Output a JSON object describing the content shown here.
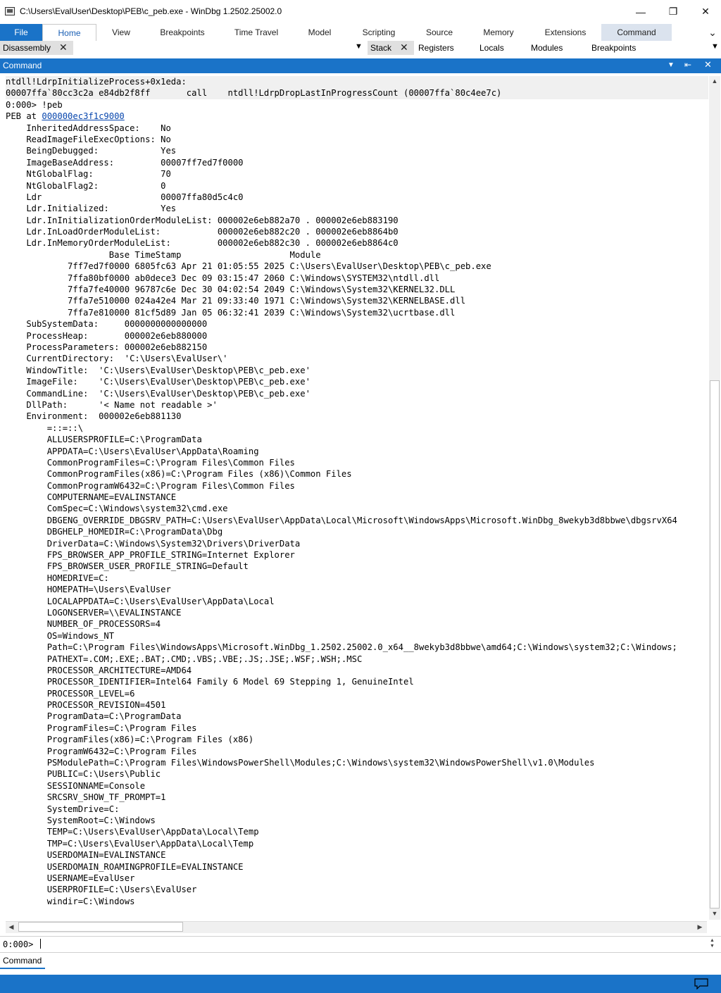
{
  "window": {
    "title": "C:\\Users\\EvalUser\\Desktop\\PEB\\c_peb.exe - WinDbg 1.2502.25002.0",
    "minimize_glyph": "—",
    "restore_glyph": "❐",
    "close_glyph": "✕"
  },
  "ribbon": {
    "tabs": [
      "File",
      "Home",
      "View",
      "Breakpoints",
      "Time Travel",
      "Model",
      "Scripting",
      "Source",
      "Memory",
      "Extensions",
      "Command"
    ],
    "expand_glyph": "⌄"
  },
  "doc_tabs": {
    "left": [
      "Disassembly"
    ],
    "right": [
      "Stack",
      "Registers",
      "Locals",
      "Modules",
      "Breakpoints"
    ]
  },
  "command_panel": {
    "title": "Command"
  },
  "output": {
    "lines": [
      "ntdll!LdrpInitializeProcess+0x1eda:",
      "00007ffa`80cc3c2a e84db2f8ff       call    ntdll!LdrpDropLastInProgressCount (00007ffa`80c4ee7c)",
      "0:000> !peb",
      "PEB at ",
      "    InheritedAddressSpace:    No",
      "    ReadImageFileExecOptions: No",
      "    BeingDebugged:            Yes",
      "    ImageBaseAddress:         00007ff7ed7f0000",
      "    NtGlobalFlag:             70",
      "    NtGlobalFlag2:            0",
      "    Ldr                       00007ffa80d5c4c0",
      "    Ldr.Initialized:          Yes",
      "    Ldr.InInitializationOrderModuleList: 000002e6eb882a70 . 000002e6eb883190",
      "    Ldr.InLoadOrderModuleList:           000002e6eb882c20 . 000002e6eb8864b0",
      "    Ldr.InMemoryOrderModuleList:         000002e6eb882c30 . 000002e6eb8864c0",
      "                    Base TimeStamp                     Module",
      "            7ff7ed7f0000 6805fc63 Apr 21 01:05:55 2025 C:\\Users\\EvalUser\\Desktop\\PEB\\c_peb.exe",
      "            7ffa80bf0000 ab0dece3 Dec 09 03:15:47 2060 C:\\Windows\\SYSTEM32\\ntdll.dll",
      "            7ffa7fe40000 96787c6e Dec 30 04:02:54 2049 C:\\Windows\\System32\\KERNEL32.DLL",
      "            7ffa7e510000 024a42e4 Mar 21 09:33:40 1971 C:\\Windows\\System32\\KERNELBASE.dll",
      "            7ffa7e810000 81cf5d89 Jan 05 06:32:41 2039 C:\\Windows\\System32\\ucrtbase.dll",
      "    SubSystemData:     0000000000000000",
      "    ProcessHeap:       000002e6eb880000",
      "    ProcessParameters: 000002e6eb882150",
      "    CurrentDirectory:  'C:\\Users\\EvalUser\\'",
      "    WindowTitle:  'C:\\Users\\EvalUser\\Desktop\\PEB\\c_peb.exe'",
      "    ImageFile:    'C:\\Users\\EvalUser\\Desktop\\PEB\\c_peb.exe'",
      "    CommandLine:  'C:\\Users\\EvalUser\\Desktop\\PEB\\c_peb.exe'",
      "    DllPath:      '< Name not readable >'",
      "    Environment:  000002e6eb881130",
      "        =::=::\\",
      "        ALLUSERSPROFILE=C:\\ProgramData",
      "        APPDATA=C:\\Users\\EvalUser\\AppData\\Roaming",
      "        CommonProgramFiles=C:\\Program Files\\Common Files",
      "        CommonProgramFiles(x86)=C:\\Program Files (x86)\\Common Files",
      "        CommonProgramW6432=C:\\Program Files\\Common Files",
      "        COMPUTERNAME=EVALINSTANCE",
      "        ComSpec=C:\\Windows\\system32\\cmd.exe",
      "        DBGENG_OVERRIDE_DBGSRV_PATH=C:\\Users\\EvalUser\\AppData\\Local\\Microsoft\\WindowsApps\\Microsoft.WinDbg_8wekyb3d8bbwe\\dbgsrvX64",
      "        DBGHELP_HOMEDIR=C:\\ProgramData\\Dbg",
      "        DriverData=C:\\Windows\\System32\\Drivers\\DriverData",
      "        FPS_BROWSER_APP_PROFILE_STRING=Internet Explorer",
      "        FPS_BROWSER_USER_PROFILE_STRING=Default",
      "        HOMEDRIVE=C:",
      "        HOMEPATH=\\Users\\EvalUser",
      "        LOCALAPPDATA=C:\\Users\\EvalUser\\AppData\\Local",
      "        LOGONSERVER=\\\\EVALINSTANCE",
      "        NUMBER_OF_PROCESSORS=4",
      "        OS=Windows_NT",
      "        Path=C:\\Program Files\\WindowsApps\\Microsoft.WinDbg_1.2502.25002.0_x64__8wekyb3d8bbwe\\amd64;C:\\Windows\\system32;C:\\Windows;",
      "        PATHEXT=.COM;.EXE;.BAT;.CMD;.VBS;.VBE;.JS;.JSE;.WSF;.WSH;.MSC",
      "        PROCESSOR_ARCHITECTURE=AMD64",
      "        PROCESSOR_IDENTIFIER=Intel64 Family 6 Model 69 Stepping 1, GenuineIntel",
      "        PROCESSOR_LEVEL=6",
      "        PROCESSOR_REVISION=4501",
      "        ProgramData=C:\\ProgramData",
      "        ProgramFiles=C:\\Program Files",
      "        ProgramFiles(x86)=C:\\Program Files (x86)",
      "        ProgramW6432=C:\\Program Files",
      "        PSModulePath=C:\\Program Files\\WindowsPowerShell\\Modules;C:\\Windows\\system32\\WindowsPowerShell\\v1.0\\Modules",
      "        PUBLIC=C:\\Users\\Public",
      "        SESSIONNAME=Console",
      "        SRCSRV_SHOW_TF_PROMPT=1",
      "        SystemDrive=C:",
      "        SystemRoot=C:\\Windows",
      "        TEMP=C:\\Users\\EvalUser\\AppData\\Local\\Temp",
      "        TMP=C:\\Users\\EvalUser\\AppData\\Local\\Temp",
      "        USERDOMAIN=EVALINSTANCE",
      "        USERDOMAIN_ROAMINGPROFILE=EVALINSTANCE",
      "        USERNAME=EvalUser",
      "        USERPROFILE=C:\\Users\\EvalUser",
      "        windir=C:\\Windows"
    ],
    "peb_link": "000000ec3f1c9000"
  },
  "input": {
    "prompt": "0:000>",
    "value": ""
  },
  "bottom_tab": {
    "label": "Command"
  },
  "colors": {
    "accent": "#1a73c8",
    "link": "#0645ad"
  }
}
